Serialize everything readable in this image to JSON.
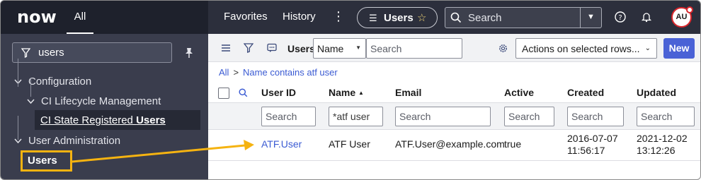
{
  "header": {
    "logo_text": "now",
    "all_label": "All",
    "favorites_label": "Favorites",
    "history_label": "History",
    "more_label": "⋮",
    "context_pill": "Users",
    "search_placeholder": "Search",
    "avatar_initials": "AU"
  },
  "navigator": {
    "filter_value": "users",
    "items": [
      {
        "label": "Configuration",
        "icon": "chevron-down-icon"
      },
      {
        "label": "CI Lifecycle Management",
        "icon": "chevron-down-icon"
      },
      {
        "label_plain": "CI State Registered ",
        "label_bold": "Users"
      },
      {
        "label": "User Administration",
        "icon": "chevron-down-icon"
      },
      {
        "label": "Users"
      }
    ]
  },
  "list": {
    "title": "Users",
    "field_select": "Name",
    "search_placeholder": "Search",
    "actions_label": "Actions on selected rows...",
    "new_label": "New",
    "breadcrumb": {
      "root": "All",
      "separator": ">",
      "condition": "Name contains atf user"
    },
    "columns": [
      {
        "label": "User ID"
      },
      {
        "label": "Name",
        "sort": "▲"
      },
      {
        "label": "Email"
      },
      {
        "label": "Active"
      },
      {
        "label": "Created"
      },
      {
        "label": "Updated"
      }
    ],
    "column_search": [
      "Search",
      "*atf user",
      "Search",
      "Search",
      "Search",
      "Search"
    ],
    "rows": [
      {
        "user_id": "ATF.User",
        "name": "ATF User",
        "email": "ATF.User@example.com",
        "active": "true",
        "created_date": "2016-07-07",
        "created_time": "11:56:17",
        "updated_date": "2021-12-02",
        "updated_time": "13:12:26"
      }
    ]
  },
  "colors": {
    "header_bg": "#2c2f3c",
    "nav_bg": "#3a3d4d",
    "accent_blue": "#4a62d6",
    "link_blue": "#3b5bd3",
    "callout_orange": "#f5b311",
    "logo_green": "#62d84e"
  }
}
